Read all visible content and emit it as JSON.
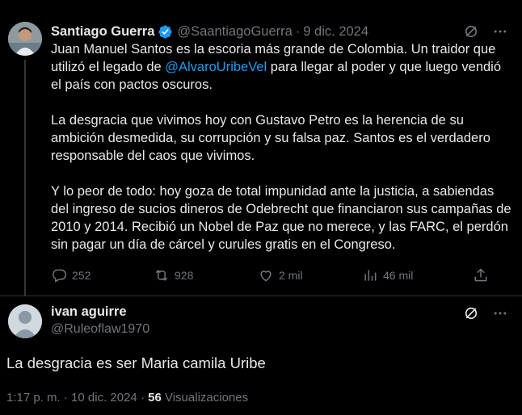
{
  "tweet": {
    "author_name": "Santiago Guerra",
    "author_handle": "@SaantiagoGuerra",
    "separator": "·",
    "date": "9 dic. 2024",
    "verified_color": "#1d9bf0",
    "paragraphs": [
      {
        "pre": "Juan Manuel Santos es la escoria más grande de Colombia. Un traidor que utilizó el legado de ",
        "mention": "@AlvaroUribeVel",
        "post": " para llegar al poder y que luego vendió el país con pactos oscuros."
      },
      {
        "text": "La desgracia que vivimos hoy con Gustavo Petro es la herencia de su ambición desmedida, su corrupción y su falsa paz. Santos es el verdadero responsable del caos que vivimos."
      },
      {
        "text": "Y lo peor de todo: hoy goza de total impunidad ante la justicia, a sabiendas del ingreso de sucios dineros de Odebrecht que financiaron sus campañas de 2010 y 2014. Recibió un Nobel de Paz que no merece, y las FARC, el perdón sin pagar un día de cárcel y curules gratis en el Congreso."
      }
    ],
    "actions": {
      "replies": "252",
      "retweets": "928",
      "likes": "2 mil",
      "views": "46 mil"
    }
  },
  "reply": {
    "author_name": "ivan aguirre",
    "author_handle": "@Ruleoflaw1970",
    "text": "La desgracia es ser Maria camila Uribe",
    "time": "1:17 p. m.",
    "separator": "·",
    "date": "10 dic. 2024",
    "separator2": "·",
    "view_count": "56",
    "views_label": "Visualizaciones"
  },
  "colors": {
    "background": "#000000",
    "text": "#e7e9ea",
    "muted": "#71767b",
    "link": "#1d9bf0"
  }
}
